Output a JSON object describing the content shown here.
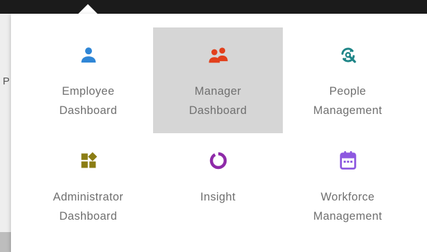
{
  "menu": {
    "items": [
      {
        "line1": "Employee",
        "line2": "Dashboard",
        "icon": "person-icon",
        "color": "#2f86d6",
        "active": false
      },
      {
        "line1": "Manager",
        "line2": "Dashboard",
        "icon": "people-icon",
        "color": "#e2401c",
        "active": true
      },
      {
        "line1": "People",
        "line2": "Management",
        "icon": "refresh-search-icon",
        "color": "#1e8587",
        "active": false
      },
      {
        "line1": "Administrator",
        "line2": "Dashboard",
        "icon": "dashboard-tiles-icon",
        "color": "#8b7d14",
        "active": false
      },
      {
        "line1": "Insight",
        "line2": "",
        "icon": "ring-chart-icon",
        "color": "#8e2aa8",
        "active": false
      },
      {
        "line1": "Workforce",
        "line2": "Management",
        "icon": "calendar-icon",
        "color": "#8d58e0",
        "active": false
      }
    ]
  },
  "background_page": {
    "partial_letter": "P"
  }
}
